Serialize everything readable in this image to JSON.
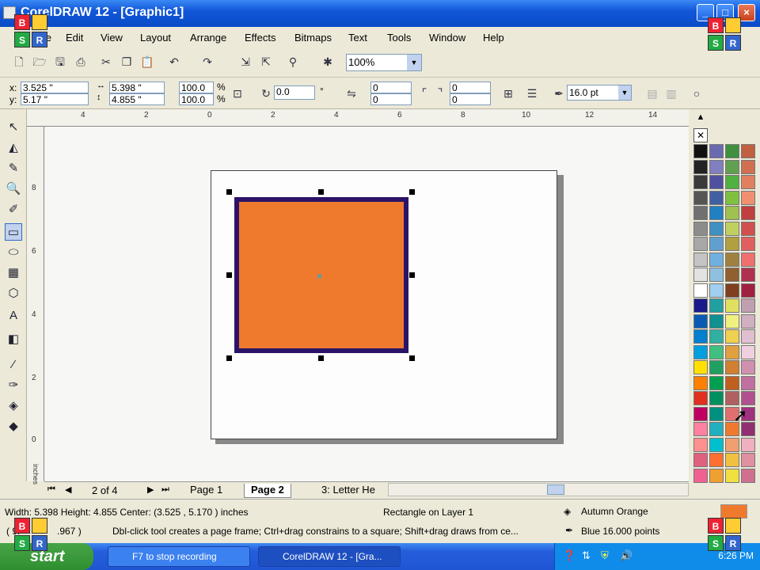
{
  "window": {
    "title": "CorelDRAW 12 - [Graphic1]",
    "min": "_",
    "max": "□",
    "close": "×"
  },
  "menu": [
    "File",
    "Edit",
    "View",
    "Layout",
    "Arrange",
    "Effects",
    "Bitmaps",
    "Text",
    "Tools",
    "Window",
    "Help"
  ],
  "toolbar": {
    "zoom": "100%"
  },
  "propbar": {
    "x": "3.525 \"",
    "y": "5.17 \"",
    "width": "5.398 \"",
    "height": "4.855 \"",
    "scale_x": "100.0",
    "scale_y": "100.0",
    "scale_unit": "%",
    "rotation": "0.0",
    "degree": "°",
    "corner_tl": "0",
    "corner_bl": "0",
    "corner_tr": "0",
    "corner_br": "0",
    "outline_width": "16.0 pt",
    "x_label": "x:",
    "y_label": "y:"
  },
  "ruler": {
    "h": [
      "4",
      "2",
      "0",
      "2",
      "4",
      "6",
      "8",
      "10",
      "12",
      "14"
    ],
    "v": [
      "8",
      "6",
      "4",
      "2",
      "0"
    ],
    "unit": "inches"
  },
  "tabs": {
    "counter": "2 of 4",
    "items": [
      "Page 1",
      "Page 2",
      "3: Letter He"
    ],
    "active": 1
  },
  "status": {
    "dims": "Width: 5.398  Height: 4.855  Center: (3.525 , 5.170 )  inches",
    "object": "Rectangle on Layer 1",
    "fill": "Autumn Orange",
    "hint": "Dbl-click tool creates a page frame; Ctrl+drag constrains to a square; Shift+drag draws from ce...",
    "outline": "Blue  16.000 points",
    "coords_partial": "( 9.",
    "coords_tail": ".967 )"
  },
  "taskbar": {
    "start": "start",
    "tasks": [
      "F7 to stop recording",
      "CorelDRAW 12 - [Gra..."
    ],
    "clock": "6:26 PM"
  },
  "logo": {
    "b": "B",
    "s": "S",
    "r": "R"
  },
  "colors": {
    "fill": "#ef7a2e",
    "outline": "#2b1467",
    "title": "#1157d9"
  }
}
